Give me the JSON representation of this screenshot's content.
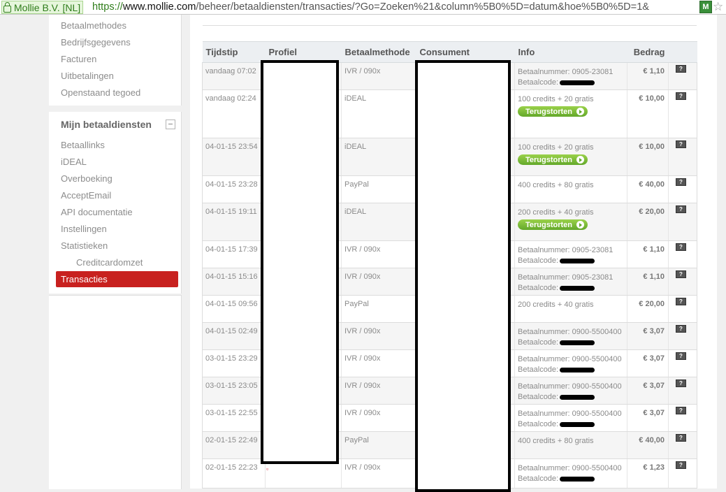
{
  "browser": {
    "ev_label": "Mollie B.V. [NL]",
    "url_scheme": "https://",
    "url_domain": "www.mollie.com",
    "url_rest": "/beheer/betaaldiensten/transacties/?Go=Zoeken%21&column%5B0%5D=datum&hoe%5B0%5D=1&",
    "ext_icon": "M"
  },
  "sidebar": {
    "top_items": [
      "Betaalmethodes",
      "Bedrijfsgegevens",
      "Facturen",
      "Uitbetalingen",
      "Openstaand tegoed"
    ],
    "section_title": "Mijn betaaldiensten",
    "items": [
      "Betaallinks",
      "iDEAL",
      "Overboeking",
      "AcceptEmail",
      "API documentatie",
      "Instellingen",
      "Statistieken"
    ],
    "sub_item": "Creditcardomzet",
    "active_item": "Transacties"
  },
  "table": {
    "headers": {
      "time": "Tijdstip",
      "profile": "Profiel",
      "method": "Betaalmethode",
      "consumer": "Consument",
      "info": "Info",
      "amount": "Bedrag"
    },
    "refund_label": "Terugstorten",
    "help_icon": "?",
    "rows": [
      {
        "time": "vandaag 07:02",
        "method": "IVR / 090x",
        "info1": "Betaalnummer: 0905-23081",
        "info2": "Betaalcode:",
        "refund": false,
        "amount": "€ 1,10"
      },
      {
        "time": "vandaag 02:24",
        "method": "iDEAL",
        "info1": "100 credits + 20 gratis",
        "info2": "",
        "refund": true,
        "amount": "€ 10,00"
      },
      {
        "time": "04-01-15 23:54",
        "method": "iDEAL",
        "info1": "100 credits + 20 gratis",
        "info2": "",
        "refund": true,
        "amount": "€ 10,00"
      },
      {
        "time": "04-01-15 23:28",
        "method": "PayPal",
        "info1": "400 credits + 80 gratis",
        "info2": "",
        "refund": false,
        "amount": "€ 40,00"
      },
      {
        "time": "04-01-15 19:11",
        "method": "iDEAL",
        "info1": "200 credits + 40 gratis",
        "info2": "",
        "refund": true,
        "amount": "€ 20,00"
      },
      {
        "time": "04-01-15 17:39",
        "method": "IVR / 090x",
        "info1": "Betaalnummer: 0905-23081",
        "info2": "Betaalcode:",
        "refund": false,
        "amount": "€ 1,10"
      },
      {
        "time": "04-01-15 15:16",
        "method": "IVR / 090x",
        "info1": "Betaalnummer: 0905-23081",
        "info2": "Betaalcode:",
        "refund": false,
        "amount": "€ 1,10"
      },
      {
        "time": "04-01-15 09:56",
        "method": "PayPal",
        "info1": "200 credits + 40 gratis",
        "info2": "",
        "refund": false,
        "amount": "€ 20,00"
      },
      {
        "time": "04-01-15 02:49",
        "method": "IVR / 090x",
        "info1": "Betaalnummer: 0900-5500400",
        "info2": "Betaalcode:",
        "refund": false,
        "amount": "€ 3,07"
      },
      {
        "time": "03-01-15 23:29",
        "method": "IVR / 090x",
        "info1": "Betaalnummer: 0900-5500400",
        "info2": "Betaalcode:",
        "refund": false,
        "amount": "€ 3,07"
      },
      {
        "time": "03-01-15 23:05",
        "method": "IVR / 090x",
        "info1": "Betaalnummer: 0900-5500400",
        "info2": "Betaalcode:",
        "refund": false,
        "amount": "€ 3,07"
      },
      {
        "time": "03-01-15 22:55",
        "method": "IVR / 090x",
        "info1": "Betaalnummer: 0900-5500400",
        "info2": "Betaalcode:",
        "refund": false,
        "amount": "€ 3,07"
      },
      {
        "time": "02-01-15 22:49",
        "method": "PayPal",
        "info1": "400 credits + 80 gratis",
        "info2": "",
        "refund": false,
        "amount": "€ 40,00"
      },
      {
        "time": "02-01-15 22:23",
        "method": "IVR / 090x",
        "info1": "Betaalnummer: 0900-5500400",
        "info2": "Betaalcode:",
        "refund": false,
        "amount": "€ 1,23"
      }
    ]
  },
  "colors": {
    "active_nav": "#c8211f",
    "refund_button": "#7cbf36",
    "ev_green": "#2f7d1b"
  }
}
